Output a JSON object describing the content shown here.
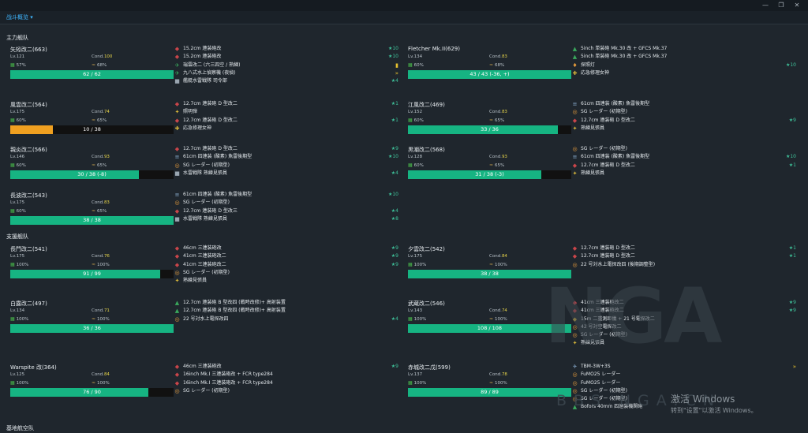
{
  "titlebar": {
    "min": "—",
    "restore": "❐",
    "close": "✕"
  },
  "tab": {
    "label": "战斗概览 ▾"
  },
  "fleets": {
    "main": "主力舰队",
    "escort": "支援舰队",
    "base": "基地航空队"
  },
  "ships": [
    {
      "name": "矢矧改二(663)",
      "lv": "Lv.121",
      "cond_label": "Cond.",
      "cond": "100",
      "cond_color": "#e8d64a",
      "fuel": "57%",
      "ammo": "68%",
      "hp": "62 / 62",
      "hp_frac": 1.0,
      "hp_color": "#16b482"
    },
    {
      "name": "Fletcher Mk.II(629)",
      "lv": "Lv.134",
      "cond_label": "Cond.",
      "cond": "83",
      "cond_color": "#e8d64a",
      "fuel": "60%",
      "ammo": "68%",
      "hp": "43 / 43 (-36, +)",
      "hp_frac": 1.0,
      "hp_color": "#16b482"
    },
    {
      "name": "風雲改二(564)",
      "lv": "Lv.175",
      "cond_label": "Cond.",
      "cond": "74",
      "cond_color": "#e8d64a",
      "fuel": "60%",
      "ammo": "65%",
      "hp": "10 / 38",
      "hp_frac": 0.263,
      "hp_color": "#f0a020"
    },
    {
      "name": "江風改二(469)",
      "lv": "Lv.152",
      "cond_label": "Cond.",
      "cond": "83",
      "cond_color": "#e8d64a",
      "fuel": "60%",
      "ammo": "65%",
      "hp": "33 / 36",
      "hp_frac": 0.917,
      "hp_color": "#16b482"
    },
    {
      "name": "親炎改二(566)",
      "lv": "Lv.146",
      "cond_label": "Cond.",
      "cond": "93",
      "cond_color": "#e8d64a",
      "fuel": "60%",
      "ammo": "65%",
      "hp": "30 / 38 (-8)",
      "hp_frac": 0.789,
      "hp_color": "#16b482"
    },
    {
      "name": "黒潮改二(568)",
      "lv": "Lv.128",
      "cond_label": "Cond.",
      "cond": "93",
      "cond_color": "#e8d64a",
      "fuel": "60%",
      "ammo": "65%",
      "hp": "31 / 38 (-3)",
      "hp_frac": 0.816,
      "hp_color": "#16b482"
    },
    {
      "name": "長波改二(543)",
      "lv": "Lv.175",
      "cond_label": "Cond.",
      "cond": "83",
      "cond_color": "#e8d64a",
      "fuel": "60%",
      "ammo": "65%",
      "hp": "38 / 38",
      "hp_frac": 1.0,
      "hp_color": "#16b482"
    },
    {
      "name": "長門改二(541)",
      "lv": "Lv.175",
      "cond_label": "Cond.",
      "cond": "76",
      "cond_color": "#e8d64a",
      "fuel": "100%",
      "ammo": "100%",
      "hp": "91 / 99",
      "hp_frac": 0.919,
      "hp_color": "#16b482"
    },
    {
      "name": "夕雲改二(542)",
      "lv": "Lv.175",
      "cond_label": "Cond.",
      "cond": "84",
      "cond_color": "#e8d64a",
      "fuel": "100%",
      "ammo": "100%",
      "hp": "38 / 38",
      "hp_frac": 1.0,
      "hp_color": "#16b482"
    },
    {
      "name": "白露改二(497)",
      "lv": "Lv.134",
      "cond_label": "Cond.",
      "cond": "71",
      "cond_color": "#e8d64a",
      "fuel": "100%",
      "ammo": "100%",
      "hp": "36 / 36",
      "hp_frac": 1.0,
      "hp_color": "#16b482"
    },
    {
      "name": "武蔵改二(546)",
      "lv": "Lv.143",
      "cond_label": "Cond.",
      "cond": "74",
      "cond_color": "#e8d64a",
      "fuel": "100%",
      "ammo": "100%",
      "hp": "108 / 108",
      "hp_frac": 1.0,
      "hp_color": "#16b482"
    },
    {
      "name": "Warspite 改(364)",
      "lv": "Lv.125",
      "cond_label": "Cond.",
      "cond": "84",
      "cond_color": "#e8d64a",
      "fuel": "100%",
      "ammo": "100%",
      "hp": "76 / 90",
      "hp_frac": 0.844,
      "hp_color": "#16b482"
    },
    {
      "name": "赤城改二戊(599)",
      "lv": "Lv.137",
      "cond_label": "Cond.",
      "cond": "78",
      "cond_color": "#e8d64a",
      "fuel": "100%",
      "ammo": "100%",
      "hp": "89 / 89",
      "hp_frac": 1.0,
      "hp_color": "#16b482"
    }
  ],
  "equips": [
    [
      {
        "icon": "◆",
        "c": "ic-red",
        "name": "15.2cm 連装砲改",
        "pf": "★10"
      },
      {
        "icon": "◆",
        "c": "ic-red",
        "name": "15.2cm 連装砲改",
        "pf": "★10"
      },
      {
        "icon": "✈",
        "c": "ic-green",
        "name": "瑞雲改二 (六三四空 / 熟練)",
        "pf": "▮"
      },
      {
        "icon": "✈",
        "c": "ic-green",
        "name": "九八式水上偵察機 (夜偵)",
        "pf": "»"
      },
      {
        "icon": "■",
        "c": "ic-grey",
        "name": "艦艇水雷戦隊 司令部",
        "pf": "★4"
      }
    ],
    [
      {
        "icon": "▲",
        "c": "ic-green",
        "name": "5inch 単装砲 Mk.30 改 + GFCS Mk.37",
        "pf": ""
      },
      {
        "icon": "▲",
        "c": "ic-green",
        "name": "5inch 単装砲 Mk.30 改 + GFCS Mk.37",
        "pf": ""
      },
      {
        "icon": "♦",
        "c": "ic-orange",
        "name": "探照灯",
        "pf": "★10"
      },
      {
        "icon": "✚",
        "c": "ic-yellow",
        "name": "応急修理女神",
        "pf": ""
      }
    ],
    [
      {
        "icon": "◆",
        "c": "ic-red",
        "name": "12.7cm 連装砲 D 型改二",
        "pf": "★1"
      },
      {
        "icon": "✦",
        "c": "ic-yellow",
        "name": "照明弾",
        "pf": ""
      },
      {
        "icon": "◆",
        "c": "ic-red",
        "name": "12.7cm 連装砲 D 型改二",
        "pf": "★1"
      },
      {
        "icon": "✚",
        "c": "ic-yellow",
        "name": "応急修理女神",
        "pf": ""
      }
    ],
    [
      {
        "icon": "≡",
        "c": "ic-blue",
        "name": "61cm 四連装 (酸素) 魚雷後期型",
        "pf": ""
      },
      {
        "icon": "◎",
        "c": "ic-orange",
        "name": "SG レーダー (初期型)",
        "pf": ""
      },
      {
        "icon": "◆",
        "c": "ic-red",
        "name": "12.7cm 連装砲 D 型改二",
        "pf": "★9"
      },
      {
        "icon": "✦",
        "c": "ic-yellow",
        "name": "熟練見張員",
        "pf": ""
      }
    ],
    [
      {
        "icon": "◆",
        "c": "ic-red",
        "name": "12.7cm 連装砲 D 型改二",
        "pf": "★9"
      },
      {
        "icon": "≡",
        "c": "ic-blue",
        "name": "61cm 四連装 (酸素) 魚雷後期型",
        "pf": "★10"
      },
      {
        "icon": "◎",
        "c": "ic-orange",
        "name": "SG レーダー (初期型)",
        "pf": ""
      },
      {
        "icon": "■",
        "c": "ic-grey",
        "name": "水雷戦隊 熟練見張員",
        "pf": "★4"
      }
    ],
    [
      {
        "icon": "◎",
        "c": "ic-orange",
        "name": "SG レーダー (初期型)",
        "pf": ""
      },
      {
        "icon": "≡",
        "c": "ic-blue",
        "name": "61cm 四連装 (酸素) 魚雷後期型",
        "pf": "★10"
      },
      {
        "icon": "◆",
        "c": "ic-red",
        "name": "12.7cm 連装砲 D 型改二",
        "pf": "★1"
      },
      {
        "icon": "✦",
        "c": "ic-yellow",
        "name": "熟練見張員",
        "pf": ""
      }
    ],
    [
      {
        "icon": "≡",
        "c": "ic-blue",
        "name": "61cm 四連装 (酸素) 魚雷後期型",
        "pf": "★10"
      },
      {
        "icon": "◎",
        "c": "ic-orange",
        "name": "SG レーダー (初期型)",
        "pf": ""
      },
      {
        "icon": "◆",
        "c": "ic-red",
        "name": "12.7cm 連装砲 D 型改三",
        "pf": "★4"
      },
      {
        "icon": "■",
        "c": "ic-grey",
        "name": "水雷戦隊 熟練見張員",
        "pf": "★8"
      }
    ],
    [
      {
        "icon": "◆",
        "c": "ic-red",
        "name": "46cm 三連装砲改",
        "pf": "★9"
      },
      {
        "icon": "◆",
        "c": "ic-red",
        "name": "41cm 三連装砲改二",
        "pf": "★9"
      },
      {
        "icon": "◆",
        "c": "ic-red",
        "name": "41cm 三連装砲改二",
        "pf": "★9"
      },
      {
        "icon": "◎",
        "c": "ic-orange",
        "name": "SG レーダー (初期型)",
        "pf": ""
      },
      {
        "icon": "✦",
        "c": "ic-yellow",
        "name": "熟練見張員",
        "pf": ""
      }
    ],
    [
      {
        "icon": "◆",
        "c": "ic-red",
        "name": "12.7cm 連装砲 D 型改二",
        "pf": "★1"
      },
      {
        "icon": "◆",
        "c": "ic-red",
        "name": "12.7cm 連装砲 D 型改二",
        "pf": "★1"
      },
      {
        "icon": "◎",
        "c": "ic-orange",
        "name": "22 号対水上電探改四 (後期調整型)",
        "pf": ""
      }
    ],
    [
      {
        "icon": "▲",
        "c": "ic-green",
        "name": "12.7cm 連装砲 B 型改四 (戦時改修)+ 高射装置",
        "pf": ""
      },
      {
        "icon": "▲",
        "c": "ic-green",
        "name": "12.7cm 連装砲 B 型改四 (戦時改修)+ 高射装置",
        "pf": ""
      },
      {
        "icon": "◎",
        "c": "ic-orange",
        "name": "22 号対水上電探改四",
        "pf": "★4"
      }
    ],
    [
      {
        "icon": "◆",
        "c": "ic-red",
        "name": "41cm 三連装砲改二",
        "pf": "★9"
      },
      {
        "icon": "◆",
        "c": "ic-red",
        "name": "41cm 三連装砲改二",
        "pf": "★9"
      },
      {
        "icon": "◆",
        "c": "ic-yellow",
        "name": "15m 二重測距儀 + 21 号電探改二",
        "pf": ""
      },
      {
        "icon": "◎",
        "c": "ic-orange",
        "name": "42 号対空電探改二",
        "pf": ""
      },
      {
        "icon": "◎",
        "c": "ic-orange",
        "name": "SG レーダー (初期型)",
        "pf": ""
      },
      {
        "icon": "✦",
        "c": "ic-yellow",
        "name": "熟練見張員",
        "pf": ""
      }
    ],
    [
      {
        "icon": "◆",
        "c": "ic-red",
        "name": "46cm 三連装砲改",
        "pf": "★9"
      },
      {
        "icon": "◆",
        "c": "ic-red",
        "name": "16inch Mk.I 三連装砲改 + FCR type284",
        "pf": ""
      },
      {
        "icon": "◆",
        "c": "ic-red",
        "name": "16inch Mk.I 三連装砲改 + FCR type284",
        "pf": ""
      },
      {
        "icon": "◎",
        "c": "ic-orange",
        "name": "SG レーダー (初期型)",
        "pf": ""
      }
    ],
    [
      {
        "icon": "✈",
        "c": "ic-blue",
        "name": "TBM-3W+3S",
        "pf": "»"
      },
      {
        "icon": "◎",
        "c": "ic-orange",
        "name": "FuMO25 レーダー",
        "pf": ""
      },
      {
        "icon": "◎",
        "c": "ic-orange",
        "name": "FuMO25 レーダー",
        "pf": ""
      },
      {
        "icon": "◎",
        "c": "ic-orange",
        "name": "SG レーダー (初期型)",
        "pf": ""
      },
      {
        "icon": "◎",
        "c": "ic-orange",
        "name": "SG レーダー (初期型)",
        "pf": ""
      },
      {
        "icon": "▲",
        "c": "ic-green",
        "name": "Bofors 40mm 四連装機関砲",
        "pf": ""
      }
    ]
  ],
  "watermark": {
    "main": "NGA",
    "sub": "BBS.NGA.CN"
  },
  "activate": {
    "line1": "激活 Windows",
    "line2": "转到\"设置\"以激活 Windows。"
  }
}
